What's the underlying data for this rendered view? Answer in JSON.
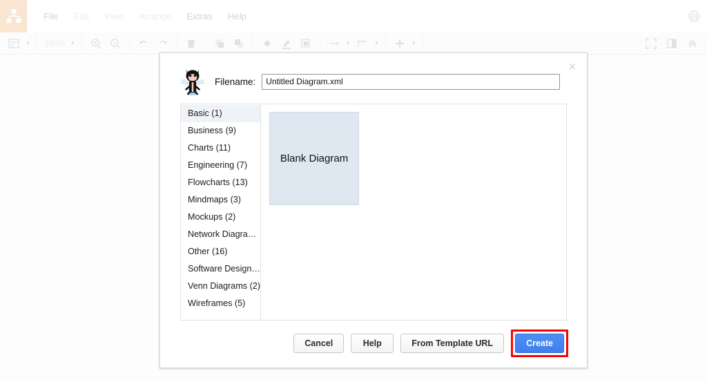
{
  "app": {
    "logo_icon": "diagram-logo-icon",
    "logo_bg": "#fae5d2",
    "globe_icon": "globe-icon"
  },
  "menubar": {
    "items": [
      {
        "label": "File",
        "enabled": true
      },
      {
        "label": "Edit",
        "enabled": false
      },
      {
        "label": "View",
        "enabled": false
      },
      {
        "label": "Arrange",
        "enabled": false
      },
      {
        "label": "Extras",
        "enabled": true
      },
      {
        "label": "Help",
        "enabled": true
      }
    ]
  },
  "toolbar": {
    "zoom_level": "100%",
    "icons": [
      "view-layout-icon",
      "zoom-level-caret",
      "zoom-in-icon",
      "zoom-out-icon",
      "undo-icon",
      "redo-icon",
      "delete-icon",
      "to-front-icon",
      "to-back-icon",
      "fill-color-icon",
      "line-color-icon",
      "shadow-icon",
      "connection-arrow-icon",
      "waypoints-icon",
      "insert-icon"
    ],
    "right_icons": [
      "fullscreen-icon",
      "format-panel-icon",
      "collapse-toolbar-icon"
    ]
  },
  "dialog": {
    "close_label": "×",
    "filename": {
      "label": "Filename:",
      "value": "Untitled Diagram.xml",
      "placeholder": "Untitled Diagram.xml"
    },
    "provider_icon": "github-octocat-icon",
    "categories": [
      {
        "label": "Basic (1)",
        "selected": true
      },
      {
        "label": "Business (9)",
        "selected": false
      },
      {
        "label": "Charts (11)",
        "selected": false
      },
      {
        "label": "Engineering (7)",
        "selected": false
      },
      {
        "label": "Flowcharts (13)",
        "selected": false
      },
      {
        "label": "Mindmaps (3)",
        "selected": false
      },
      {
        "label": "Mockups (2)",
        "selected": false
      },
      {
        "label": "Network Diagra…",
        "selected": false
      },
      {
        "label": "Other (16)",
        "selected": false
      },
      {
        "label": "Software Design …",
        "selected": false
      },
      {
        "label": "Venn Diagrams (2)",
        "selected": false
      },
      {
        "label": "Wireframes (5)",
        "selected": false
      }
    ],
    "templates": [
      {
        "label": "Blank Diagram",
        "color": "#dfe8f1"
      }
    ],
    "buttons": {
      "cancel": "Cancel",
      "help": "Help",
      "from_template_url": "From Template URL",
      "create": "Create"
    },
    "highlight_color": "#ff0000",
    "primary_color": "#4285f4"
  }
}
